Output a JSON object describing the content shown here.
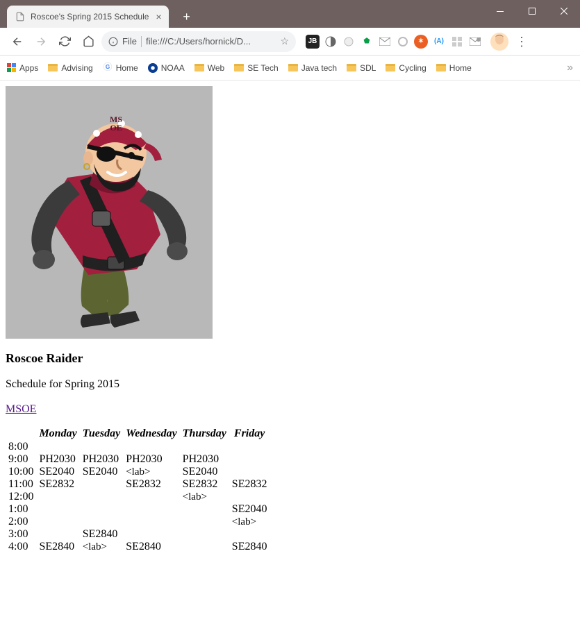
{
  "window": {
    "tab_title": "Roscoe's Spring 2015 Schedule"
  },
  "address": {
    "protocol_label": "File",
    "url_display": "file:///C:/Users/hornick/D..."
  },
  "bookmarks": {
    "items": [
      {
        "id": "apps",
        "label": "Apps",
        "icon": "apps"
      },
      {
        "id": "advising",
        "label": "Advising",
        "icon": "folder"
      },
      {
        "id": "home1",
        "label": "Home",
        "icon": "g"
      },
      {
        "id": "noaa",
        "label": "NOAA",
        "icon": "noaa"
      },
      {
        "id": "web",
        "label": "Web",
        "icon": "folder"
      },
      {
        "id": "setech",
        "label": "SE Tech",
        "icon": "folder"
      },
      {
        "id": "java",
        "label": "Java tech",
        "icon": "folder"
      },
      {
        "id": "sdl",
        "label": "SDL",
        "icon": "folder"
      },
      {
        "id": "cycling",
        "label": "Cycling",
        "icon": "folder"
      },
      {
        "id": "home2",
        "label": "Home",
        "icon": "folder"
      }
    ]
  },
  "page": {
    "heading": "Roscoe Raider",
    "subhead": "Schedule for Spring 2015",
    "link_text": "MSOE",
    "columns": [
      "",
      "Monday",
      "Tuesday",
      "Wednesday",
      "Thursday",
      "Friday"
    ],
    "rows": [
      {
        "time": "8:00",
        "cells": [
          "",
          "",
          "",
          "",
          ""
        ]
      },
      {
        "time": "9:00",
        "cells": [
          "PH2030",
          "PH2030",
          "PH2030\n<lab>",
          "PH2030",
          ""
        ]
      },
      {
        "time": "10:00",
        "cells": [
          "SE2040",
          "SE2040",
          "",
          "SE2040",
          ""
        ]
      },
      {
        "time": "11:00",
        "cells": [
          "SE2832",
          "",
          "SE2832",
          "SE2832\n<lab>",
          "SE2832"
        ]
      },
      {
        "time": "12:00",
        "cells": [
          "",
          "",
          "",
          "",
          ""
        ]
      },
      {
        "time": "1:00",
        "cells": [
          "",
          "",
          "",
          "",
          "SE2040\n<lab>"
        ]
      },
      {
        "time": "2:00",
        "cells": [
          "",
          "",
          "",
          "",
          ""
        ]
      },
      {
        "time": "3:00",
        "cells": [
          "",
          "SE2840\n<lab>",
          "",
          "",
          ""
        ]
      },
      {
        "time": "4:00",
        "cells": [
          "SE2840",
          "",
          "SE2840",
          "",
          "SE2840"
        ]
      }
    ]
  }
}
